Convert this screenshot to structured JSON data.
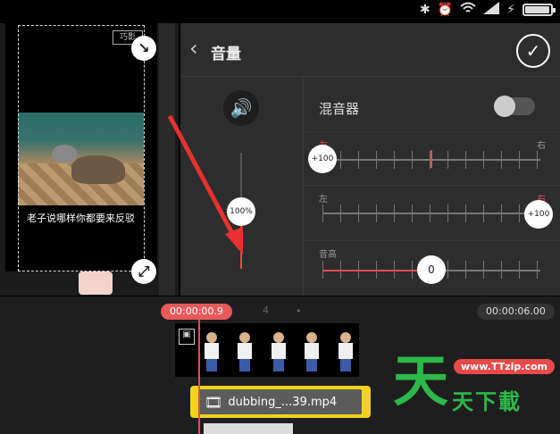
{
  "status_bar": {
    "icons": [
      "bluetooth-icon",
      "alarm-icon",
      "wifi-icon",
      "signal-icon",
      "charging-icon",
      "battery-icon"
    ]
  },
  "preview": {
    "caption": "老子说哪样你都要来反驳",
    "watermark": "巧影"
  },
  "volume_panel": {
    "title": "音量",
    "master_volume": "100%",
    "mixer_label": "混音器",
    "mixer_enabled": false,
    "balance1": {
      "left_label": "左",
      "right_label": "右",
      "value": "+100"
    },
    "balance2": {
      "left_label": "左",
      "right_label": "右",
      "value": "+100"
    },
    "pitch": {
      "label": "音高",
      "value": "0"
    }
  },
  "timeline": {
    "current_time": "00:00:00.9",
    "total_time": "00:00:06.00",
    "second_marker": "4",
    "audio_clip_name": "dubbing_...39.mp4"
  },
  "site_logo": {
    "url": "www.TTzip.com"
  },
  "colors": {
    "accent_red": "#e84a4a",
    "audio_clip_yellow": "#f2d21f",
    "logo_green": "#2cb84a"
  }
}
